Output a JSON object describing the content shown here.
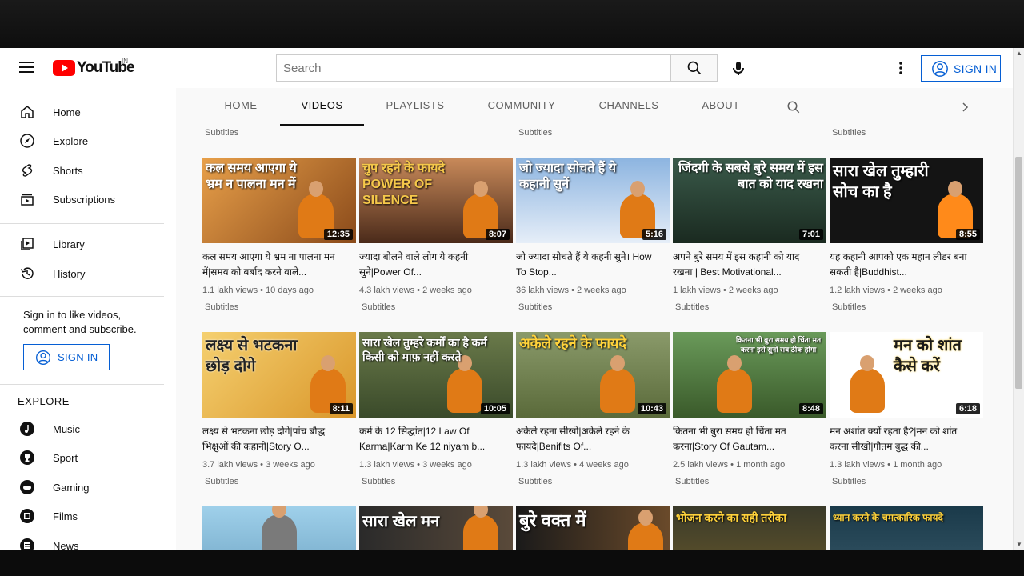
{
  "masthead": {
    "logo_text": "YouTube",
    "country_code": "IN",
    "search_placeholder": "Search",
    "sign_in": "SIGN IN"
  },
  "sidebar": {
    "items": [
      {
        "label": "Home",
        "icon": "home-icon"
      },
      {
        "label": "Explore",
        "icon": "compass-icon"
      },
      {
        "label": "Shorts",
        "icon": "shorts-icon"
      },
      {
        "label": "Subscriptions",
        "icon": "subscriptions-icon"
      },
      {
        "label": "Library",
        "icon": "library-icon"
      },
      {
        "label": "History",
        "icon": "history-icon"
      }
    ],
    "signin_note": "Sign in to like videos, comment and subscribe.",
    "sign_in": "SIGN IN",
    "explore_heading": "EXPLORE",
    "explore_items": [
      {
        "label": "Music",
        "icon": "music-icon"
      },
      {
        "label": "Sport",
        "icon": "trophy-icon"
      },
      {
        "label": "Gaming",
        "icon": "gaming-icon"
      },
      {
        "label": "Films",
        "icon": "film-icon"
      },
      {
        "label": "News",
        "icon": "news-icon"
      }
    ]
  },
  "tabs": [
    "HOME",
    "VIDEOS",
    "PLAYLISTS",
    "COMMUNITY",
    "CHANNELS",
    "ABOUT"
  ],
  "active_tab": "VIDEOS",
  "top_row_subtitles": [
    "Subtitles",
    "Subtitles",
    "Subtitles"
  ],
  "videos": [
    {
      "thumb_text": "कल समय आएगा ये भ्रम न पालना मन में",
      "duration": "12:35",
      "title": "कल समय आएगा ये भ्रम ना पालना मन में|समय को बर्बाद करने वाले...",
      "views": "1.1 lakh views",
      "age": "10 days ago",
      "badge": "Subtitles",
      "bg": "#c9772a"
    },
    {
      "thumb_text": "चुप रहने के फायदे POWER OF SILENCE",
      "duration": "8:07",
      "title": "ज्यादा बोलने वाले लोग ये कहनी सुने|Power Of...",
      "views": "4.3 lakh views",
      "age": "2 weeks ago",
      "badge": "Subtitles",
      "bg": "#6b4a3a"
    },
    {
      "thumb_text": "जो ज्यादा सोचते हैं ये कहानी सुनें",
      "duration": "5:16",
      "title": "जो ज्यादा सोचते हैं ये कहनी सुने। How To Stop...",
      "views": "36 lakh views",
      "age": "2 weeks ago",
      "badge": "Subtitles",
      "bg": "#6f9ad0"
    },
    {
      "thumb_text": "जिंदगी के सबसे बुरे समय में इस बात को याद रखना",
      "duration": "7:01",
      "title": "अपने बुरे समय में इस कहानी को याद रखना | Best Motivational...",
      "views": "1 lakh views",
      "age": "2 weeks ago",
      "badge": "Subtitles",
      "bg": "#2f4a3a"
    },
    {
      "thumb_text": "सारा खेल तुम्हारी सोच का है",
      "duration": "8:55",
      "title": "यह कहानी आपको एक महान लीडर बना सकती है|Buddhist...",
      "views": "1.2 lakh views",
      "age": "2 weeks ago",
      "badge": "Subtitles",
      "bg": "#1a1a1a"
    },
    {
      "thumb_text": "लक्ष्य से भटकना छोड़ दोगे",
      "duration": "8:11",
      "title": "लक्ष्य से भटकना छोड़ दोगे|पांच बौद्ध भिक्षुओं की कहानी|Story O...",
      "views": "3.7 lakh views",
      "age": "3 weeks ago",
      "badge": "Subtitles",
      "bg": "#e9b34a"
    },
    {
      "thumb_text": "सारा खेल तुम्हरे कर्मों का है कर्म किसी को माफ़ नहीं करते",
      "duration": "10:05",
      "title": "कर्म के 12 सिद्धांत|12 Law Of Karma|Karm Ke 12 niyam b...",
      "views": "1.3 lakh views",
      "age": "3 weeks ago",
      "badge": "Subtitles",
      "bg": "#5a6a3a"
    },
    {
      "thumb_text": "अकेले रहने के फायदे",
      "duration": "10:43",
      "title": "अकेले रहना सीखो|अकेले रहने के फायदे|Benifits Of...",
      "views": "1.3 lakh views",
      "age": "4 weeks ago",
      "badge": "Subtitles",
      "bg": "#7d8a5a"
    },
    {
      "thumb_text": "कितना भी बुरा समय हो चिंता मत करना इसे सुनो सब ठीक होगा",
      "duration": "8:48",
      "title": "कितना भी बुरा समय हो चिंता मत करना|Story Of Gautam...",
      "views": "2.5 lakh views",
      "age": "1 month ago",
      "badge": "Subtitles",
      "bg": "#4f7a3f"
    },
    {
      "thumb_text": "मन को शांत कैसे करें",
      "duration": "6:18",
      "title": "मन अशांत क्यों रहता है?|मन को शांत करना सीखो|गौतम बुद्ध की...",
      "views": "1.3 lakh views",
      "age": "1 month ago",
      "badge": "Subtitles",
      "bg": "#ffffff"
    }
  ],
  "partial_row": [
    {
      "thumb_text": "",
      "bg": "#8fc4e0"
    },
    {
      "thumb_text": "सारा खेल मन",
      "bg": "#3a3a3a"
    },
    {
      "thumb_text": "बुरे वक्त में",
      "bg": "#1f1f1f"
    },
    {
      "thumb_text": "भोजन करने का सही तरीका",
      "bg": "#2a2a2a"
    },
    {
      "thumb_text": "ध्यान करने के चमत्कारिक फायदे",
      "bg": "#1c3a4a"
    }
  ]
}
